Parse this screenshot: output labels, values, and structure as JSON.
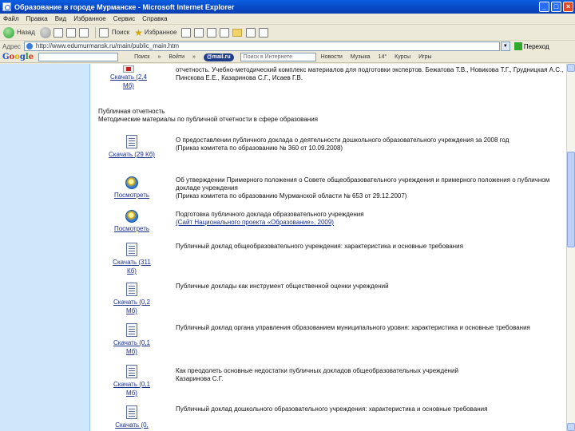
{
  "window": {
    "title": "Образование в городе Мурманске - Microsoft Internet Explorer",
    "minimize": "_",
    "maximize": "□",
    "close": "×"
  },
  "menu": [
    "Файл",
    "Правка",
    "Вид",
    "Избранное",
    "Сервис",
    "Справка"
  ],
  "toolbar": {
    "back": "Назад",
    "search": "Поиск",
    "favorites": "Избранное"
  },
  "address": {
    "label": "Адрес",
    "url": "http://www.edumurmansk.ru/main/public_main.htm",
    "go": "Переход"
  },
  "googlebar": {
    "logo": [
      "G",
      "o",
      "o",
      "g",
      "l",
      "e"
    ],
    "items": [
      "Поиск",
      "»",
      "Войти",
      "»"
    ],
    "mail": "@mail.ru",
    "search_placeholder": "Поиск в Интернете",
    "news": "Новости",
    "more": [
      "Музыка",
      "14°",
      "Курсы",
      "Игры"
    ]
  },
  "page": {
    "top_row": {
      "link": "Скачать (2,4 Мб)",
      "text": "отчетность. Учебно-методический комплекс материалов для подготовки экспертов. Бежатова Т.В., Новикова Т.Г., Грудницкая А.С., Пинскова Е.Е., Казаринова С.Г., Исаев Г.В."
    },
    "section": {
      "title": "Публичная отчетность",
      "subtitle": "Методические материалы по публичной отчетности в сфере образования"
    },
    "rows": [
      {
        "icon": "doc",
        "link": "Скачать (29 Кб)",
        "title": "О предоставлении публичного доклада о деятельности дошкольного образовательного учреждения за 2008 год",
        "sub": "(Приказ комитета по образованию № 360 от 10.09.2008)",
        "sub_is_link": false
      },
      {
        "icon": "ie",
        "link": "Посмотреть",
        "title": "Об утверждении Примерного положения о Совете общеобразовательного учреждения и примерного положения о публичном докладе учреждения",
        "sub": "(Приказ комитета по образованию Мурманской области № 653 от 29.12.2007)",
        "sub_is_link": false
      },
      {
        "icon": "ie",
        "link": "Посмотреть",
        "title": "Подготовка публичного доклада образовательного учреждения",
        "sub": "(Сайт Национального проекта «Образование», 2009)",
        "sub_is_link": true
      },
      {
        "icon": "doc",
        "link": "Скачать (311 Кб)",
        "title": "Публичный доклад общеобразовательного учреждения: характеристика и основные требования",
        "sub": "",
        "sub_is_link": false
      },
      {
        "icon": "doc",
        "link": "Скачать (0,2 Мб)",
        "title": "Публичные доклады как инструмент общественной оценки учреждений",
        "sub": "",
        "sub_is_link": false
      },
      {
        "icon": "doc",
        "link": "Скачать (0,1 Мб)",
        "title": "Публичный доклад органа управления образованием муниципального уровня: характеристика и основные требования",
        "sub": "",
        "sub_is_link": false
      },
      {
        "icon": "doc",
        "link": "Скачать (0,1 Мб)",
        "title": "Как преодолеть основные недостатки публичных докладов общеобразовательных учреждений",
        "sub": "Казаринова С.Г.",
        "sub_is_link": false
      },
      {
        "icon": "doc",
        "link": "Скачать (0,",
        "title": "Публичный доклад дошкольного образовательного учреждения: характеристика и основные требования",
        "sub": "",
        "sub_is_link": false
      }
    ]
  }
}
